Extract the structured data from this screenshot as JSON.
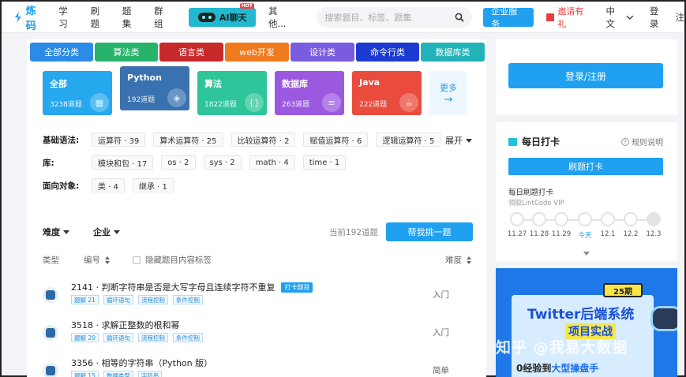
{
  "nav": {
    "logo": "炼码",
    "links": [
      "学习",
      "刷题",
      "题集",
      "群组"
    ],
    "ai_label": "AI聊天",
    "hot": "HOT",
    "more": "其他...",
    "search_placeholder": "搜索题目、标签、题集",
    "enterprise": "企业服务",
    "invite": "邀请有礼",
    "language": "中文",
    "login": "登录",
    "register": "注"
  },
  "categories": [
    {
      "label": "全部分类",
      "color": "#2b8be6"
    },
    {
      "label": "算法类",
      "color": "#28b36a"
    },
    {
      "label": "语言类",
      "color": "#c7292b"
    },
    {
      "label": "web开发",
      "color": "#f07a1e"
    },
    {
      "label": "设计类",
      "color": "#7a5ce0"
    },
    {
      "label": "命令行类",
      "color": "#1b3ad1"
    },
    {
      "label": "数据库类",
      "color": "#22b2b8"
    }
  ],
  "tiles": [
    {
      "name": "全部",
      "count": "3238道题",
      "color": "#25a8ee",
      "icon": "grid-icon"
    },
    {
      "name": "Python",
      "count": "192道题",
      "color": "#3a72b0",
      "icon": "python-icon"
    },
    {
      "name": "算法",
      "count": "1822道题",
      "color": "#2ec59a",
      "icon": "braces-icon"
    },
    {
      "name": "数据库",
      "count": "263道题",
      "color": "#9b59e0",
      "icon": "database-icon"
    },
    {
      "name": "Java",
      "count": "222道题",
      "color": "#e94b3c",
      "icon": "java-icon"
    }
  ],
  "more_tile": "更多",
  "tag_rows": [
    {
      "label": "基础语法:",
      "chips": [
        "运算符 · 39",
        "算术运算符 · 25",
        "比较运算符 · 2",
        "赋值运算符 · 6",
        "逻辑运算符 · 5"
      ]
    },
    {
      "label": "库:",
      "chips": [
        "模块和包 · 17",
        "os · 2",
        "sys · 2",
        "math · 4",
        "time · 1"
      ]
    },
    {
      "label": "面向对象:",
      "chips": [
        "类 · 4",
        "继承 · 1"
      ]
    }
  ],
  "expand": "展开",
  "filters": {
    "difficulty": "难度",
    "company": "企业",
    "count_text": "当前192道题",
    "challenge": "帮我挑一题"
  },
  "list_head": {
    "type": "类型",
    "number": "编号",
    "hide_tags": "隐藏题目内容标签",
    "difficulty": "难度"
  },
  "questions": [
    {
      "title": "2141 · 判断字符串是否是大写字母且连续字符不重复",
      "badge": "打卡题目",
      "tags": [
        "题解 21",
        "循环语句",
        "流程控制",
        "条件控制"
      ],
      "difficulty": "入门"
    },
    {
      "title": "3518 · 求解正整数的根和幂",
      "badge": "",
      "tags": [
        "题解 20",
        "循环语句",
        "流程控制",
        "条件控制"
      ],
      "difficulty": "入门"
    },
    {
      "title": "3356 · 相等的字符串（Python 版）",
      "badge": "",
      "tags": [
        "题解 15",
        "数据类型",
        "字符串"
      ],
      "difficulty": "简单"
    }
  ],
  "sidebar": {
    "login_register": "登录/注册",
    "checkin_title": "每日打卡",
    "rules": "规则说明",
    "checkin_btn": "刷题打卡",
    "daily": "每日刷题打卡",
    "daily_sub": "领取LintCode VIP",
    "dates": [
      "11.27",
      "11.28",
      "11.29",
      "今天",
      "12.1",
      "12.2",
      "12.3"
    ]
  },
  "banner": {
    "period": "25期",
    "title": "Twitter后端系统",
    "subtitle": "项目实战",
    "line_prefix": "0经验到",
    "line_highlight": "大型操盘手",
    "watermark": "知乎 @我易大数据"
  }
}
